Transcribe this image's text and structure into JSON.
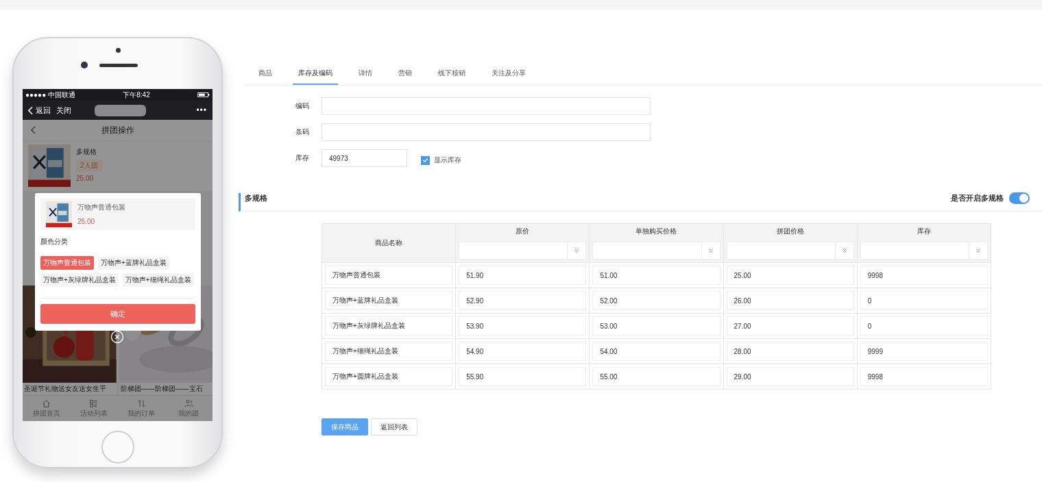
{
  "phone": {
    "status_bar": {
      "carrier": "●●●●● 中国联通",
      "time": "下午8:42"
    },
    "nav": {
      "back": "返回",
      "close": "关闭",
      "more": "•••"
    },
    "page_title": "拼团操作",
    "product": {
      "name": "多规格",
      "badge": "2人团",
      "price": "25.00"
    },
    "popup": {
      "name": "万物声普通包装",
      "price": "25.00",
      "group_label": "颜色分类",
      "options": [
        {
          "label": "万物声普通包装",
          "selected": true
        },
        {
          "label": "万物声+蓝牌礼品盒装",
          "selected": false
        },
        {
          "label": "万物声+灰绿牌礼品盒装",
          "selected": false
        },
        {
          "label": "万物声+细绳礼品盒装",
          "selected": false
        }
      ],
      "confirm": "确定"
    },
    "cards": [
      {
        "title": "圣诞节礼物送女友送女生平",
        "kind": "picture"
      },
      {
        "title": "阶梯团——阶梯团——宝石",
        "kind": "picture"
      }
    ],
    "tabbar": [
      {
        "label": "拼团首页"
      },
      {
        "label": "活动列表"
      },
      {
        "label": "我的订单"
      },
      {
        "label": "我的团"
      }
    ]
  },
  "tabs": [
    {
      "label": "商品",
      "selected": false
    },
    {
      "label": "库存及编码",
      "selected": true
    },
    {
      "label": "详情",
      "selected": false
    },
    {
      "label": "营销",
      "selected": false
    },
    {
      "label": "线下核销",
      "selected": false
    },
    {
      "label": "关注及分享",
      "selected": false
    }
  ],
  "fields": [
    {
      "label": "编码"
    },
    {
      "label": "条码"
    },
    {
      "label": "库存",
      "value": "49973"
    }
  ],
  "show_stock": {
    "label": "显示库存",
    "checked": true
  },
  "section": {
    "title": "多规格",
    "toggle_label": "是否开启多规格",
    "toggle_on": true
  },
  "table": {
    "columns": [
      "商品名称",
      "原价",
      "单独购买价格",
      "拼团价格",
      "库存"
    ],
    "rows": [
      [
        "万物声普通包装",
        "51.90",
        "51.00",
        "25.00",
        "9998"
      ],
      [
        "万物声+蓝牌礼品盒装",
        "52.90",
        "52.00",
        "26.00",
        "0"
      ],
      [
        "万物声+灰绿牌礼品盒装",
        "53.90",
        "53.00",
        "27.00",
        "0"
      ],
      [
        "万物声+细绳礼品盒装",
        "54.90",
        "54.00",
        "28.00",
        "9999"
      ],
      [
        "万物声+圆牌礼品盒装",
        "55.90",
        "55.00",
        "29.00",
        "9998"
      ]
    ]
  },
  "buttons": [
    {
      "label": "保存商品",
      "kind": "primary"
    },
    {
      "label": "返回列表",
      "kind": "default"
    }
  ]
}
